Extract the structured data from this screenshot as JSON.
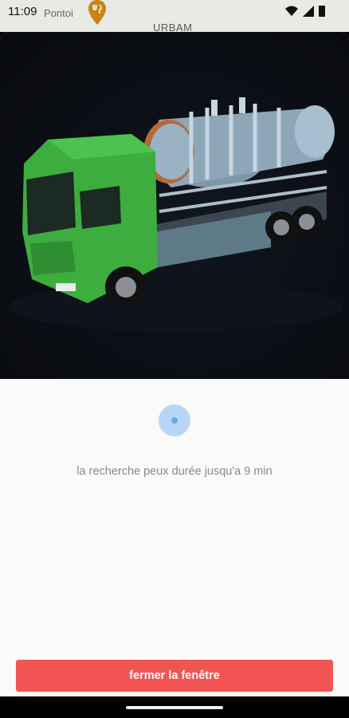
{
  "status_bar": {
    "time": "11:09",
    "map_label_left": "Pontoi",
    "map_label_center": "URBAM"
  },
  "modal": {
    "image_alt": "truck-illustration",
    "loading_text": "la recherche peux durée jusqu'a 9 min",
    "close_button_label": "fermer la fenêtre"
  },
  "colors": {
    "accent_button": "#f25353",
    "loader": "#b8d6f6",
    "truck_cab": "#3dad3f"
  }
}
